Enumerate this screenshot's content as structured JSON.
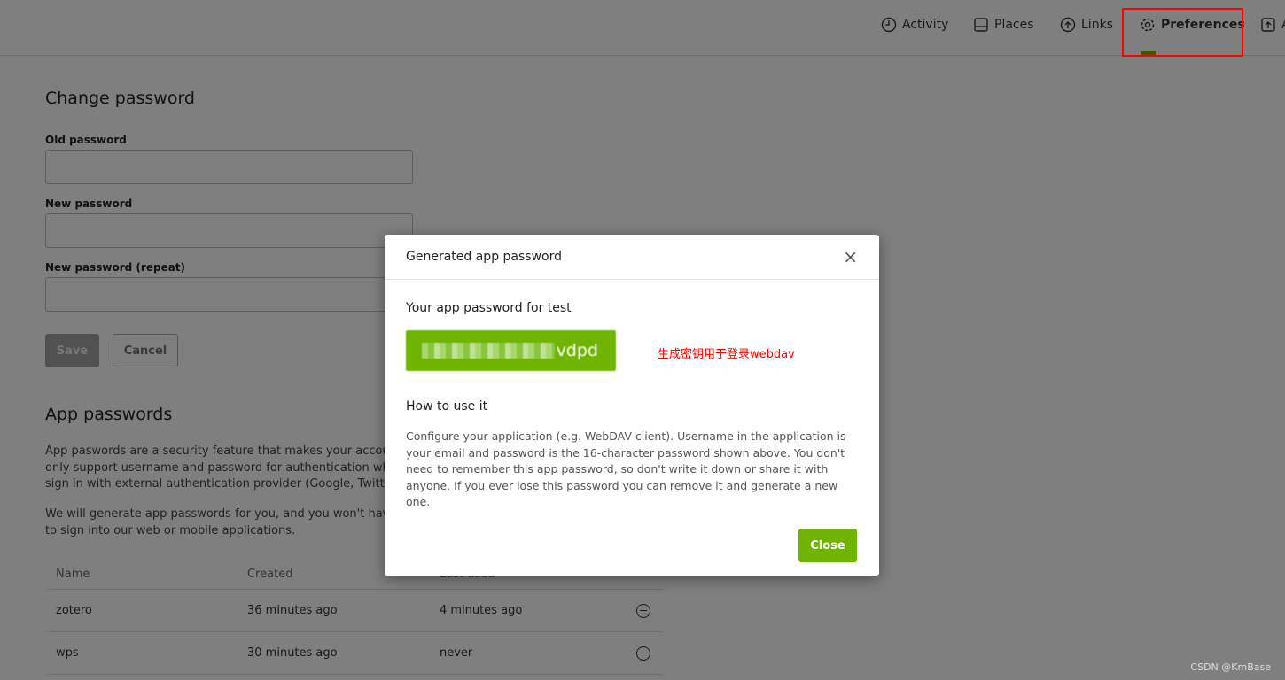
{
  "nav": {
    "items": [
      {
        "label": "Activity",
        "icon": "clock-icon"
      },
      {
        "label": "Places",
        "icon": "drive-icon"
      },
      {
        "label": "Links",
        "icon": "cloud-upload-icon"
      },
      {
        "label": "Preferences",
        "icon": "gear-icon",
        "active": true
      },
      {
        "label": "A",
        "icon": "upload-icon"
      }
    ]
  },
  "change_password": {
    "title": "Change password",
    "old_label": "Old password",
    "new_label": "New password",
    "repeat_label": "New password (repeat)",
    "save": "Save",
    "cancel": "Cancel"
  },
  "app_passwords": {
    "title": "App passwords",
    "desc1": "App paswords are a security feature that makes your account m\nonly support username and password for authentication which\nsign in with external authentication provider (Google, Twitter...).",
    "desc2": "We will generate app passwords for you, and you won't have to\nto sign into our web or mobile applications.",
    "columns": [
      "Name",
      "Created",
      "Last used"
    ],
    "rows": [
      {
        "name": "zotero",
        "created": "36 minutes ago",
        "last_used": "4 minutes ago"
      },
      {
        "name": "wps",
        "created": "30 minutes ago",
        "last_used": "never"
      }
    ]
  },
  "modal": {
    "title": "Generated app password",
    "subtitle": "Your app password for test",
    "password_visible": "vdpd",
    "annotation": "生成密钥用于登录webdav",
    "how_title": "How to use it",
    "how_text": "Configure your application (e.g. WebDAV client). Username in the application is your email and password is the 16-character password shown above. You don't need to remember this app password, so don't write it down or share it with anyone. If you ever lose this password you can remove it and generate a new one.",
    "close": "Close"
  },
  "watermark": "CSDN @KmBase",
  "colors": {
    "accent": "#6fb400",
    "highlight": "#ff0000"
  }
}
